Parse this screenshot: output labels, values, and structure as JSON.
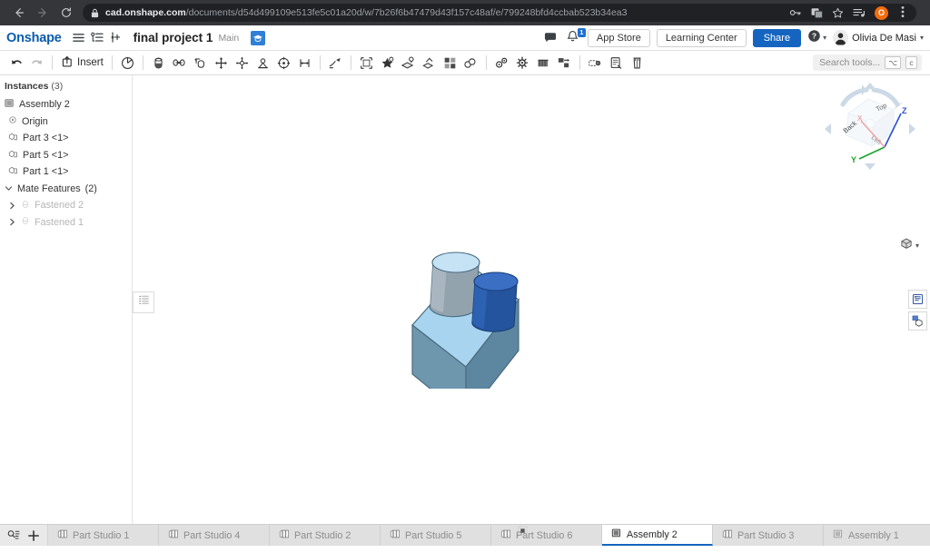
{
  "browser": {
    "back_icon": "back-arrow-icon",
    "forward_icon": "forward-arrow-icon",
    "reload_icon": "reload-icon",
    "url_domain": "cad.onshape.com",
    "url_path": "/documents/d54d499109e513fe5c01a20d/w/7b26f6b47479d43f157c48af/e/799248bfd4ccbab523b34ea3",
    "lock_icon": "lock-icon",
    "key_icon": "key-icon",
    "translate_icon": "translate-icon",
    "bookmark_icon": "star-icon",
    "media_icon": "media-list-icon",
    "profile_initial": "O",
    "menu_icon": "kebab-menu-icon"
  },
  "header": {
    "logo": "Onshape",
    "menu_icon": "hamburger-menu-icon",
    "tree_icon": "document-tree-icon",
    "versions_icon": "version-branch-icon",
    "doc_title": "final project 1",
    "branch": "Main",
    "learning_icon": "graduation-cap-icon",
    "comment_icon": "comment-icon",
    "bell_icon": "notification-bell-icon",
    "notification_count": "1",
    "app_store": "App Store",
    "learning_center": "Learning Center",
    "share": "Share",
    "help_icon": "help-circle-icon",
    "user_name": "Olivia De Masi",
    "avatar_icon": "user-avatar-icon"
  },
  "toolbar": {
    "undo_icon": "undo-arrow-icon",
    "redo_icon": "redo-arrow-icon",
    "insert_label": "Insert",
    "insert_icon": "insert-part-icon",
    "search_placeholder": "Search tools...",
    "search_key_1": "⌥",
    "search_key_2": "c",
    "tools": [
      {
        "name": "fix-tool",
        "icon": "fix-circle-icon"
      },
      {
        "name": "group-tool",
        "icon": "group-cylinder-icon"
      },
      {
        "name": "revolute-mate",
        "icon": "revolute-mate-icon"
      },
      {
        "name": "cylindrical-mate",
        "icon": "cylindrical-mate-icon"
      },
      {
        "name": "slider-mate",
        "icon": "slider-mate-icon"
      },
      {
        "name": "planar-mate",
        "icon": "planar-mate-icon"
      },
      {
        "name": "ball-mate",
        "icon": "ball-mate-icon"
      },
      {
        "name": "pin-slot-mate",
        "icon": "pin-slot-mate-icon"
      },
      {
        "name": "parallel-mate",
        "icon": "parallel-mate-icon"
      },
      {
        "name": "tangent-mate",
        "icon": "tangent-mate-icon"
      },
      {
        "name": "fastened-mate",
        "icon": "fastened-mate-icon"
      },
      {
        "name": "mate-connector",
        "icon": "mate-connector-icon"
      },
      {
        "name": "group-instances",
        "icon": "group-instances-icon"
      },
      {
        "name": "replicate-tool",
        "icon": "replicate-icon"
      },
      {
        "name": "pattern-tool",
        "icon": "pattern-icon"
      },
      {
        "name": "gear-relation",
        "icon": "gear-relation-icon"
      },
      {
        "name": "screw-relation",
        "icon": "screw-relation-icon"
      },
      {
        "name": "rack-pinion",
        "icon": "rack-pinion-icon"
      },
      {
        "name": "linear-relation",
        "icon": "linear-relation-icon"
      },
      {
        "name": "exploded-view",
        "icon": "exploded-view-icon"
      },
      {
        "name": "bill-of-materials",
        "icon": "bom-icon"
      },
      {
        "name": "measure-tool",
        "icon": "measure-icon"
      }
    ]
  },
  "tree": {
    "header_label": "Instances",
    "header_count": "(3)",
    "root": {
      "label": "Assembly 2",
      "icon": "assembly-icon"
    },
    "origin": {
      "label": "Origin",
      "icon": "origin-icon"
    },
    "instances": [
      {
        "label": "Part 3 <1>",
        "icon": "part-icon"
      },
      {
        "label": "Part 5 <1>",
        "icon": "part-icon"
      },
      {
        "label": "Part 1 <1>",
        "icon": "part-icon"
      }
    ],
    "mate_features": {
      "label": "Mate Features",
      "count": "(2)"
    },
    "mates": [
      {
        "label": "Fastened 2",
        "icon": "fastened-feature-icon"
      },
      {
        "label": "Fastened 1",
        "icon": "fastened-feature-icon"
      }
    ]
  },
  "viewport": {
    "panel_toggle_icon": "list-panel-icon",
    "display_list_icon": "display-list-icon",
    "appearance_icon": "appearance-cube-icon",
    "origin_marker_icon": "origin-marker-icon",
    "view_mode_icon": "shaded-cube-icon",
    "viewcube": {
      "axis_x_label": "X",
      "axis_y_label": "Y",
      "axis_z_label": "Z",
      "face_top": "Top",
      "face_back": "Back",
      "face_left": "Left"
    },
    "model": {
      "box_color": "#5d86a0",
      "box_top_color": "#a8d4ef",
      "box_front_color": "#7aa6bd",
      "cylinder_grey": "#9aa7b0",
      "cylinder_blue": "#24549e",
      "cylinder_blue_top": "#3a6fc4",
      "cylinder_grey_top": "#c6e3f6"
    }
  },
  "tabbar": {
    "search_tabs_icon": "search-tabs-icon",
    "add_tab_icon": "add-tab-icon",
    "tabs": [
      {
        "label": "Part Studio 1",
        "icon": "part-studio-icon",
        "active": false
      },
      {
        "label": "Part Studio 4",
        "icon": "part-studio-icon",
        "active": false
      },
      {
        "label": "Part Studio 2",
        "icon": "part-studio-icon",
        "active": false
      },
      {
        "label": "Part Studio 5",
        "icon": "part-studio-icon",
        "active": false
      },
      {
        "label": "Part Studio 6",
        "icon": "part-studio-icon",
        "active": false
      },
      {
        "label": "Assembly 2",
        "icon": "assembly-tab-icon",
        "active": true
      },
      {
        "label": "Part Studio 3",
        "icon": "part-studio-icon",
        "active": false
      },
      {
        "label": "Assembly 1",
        "icon": "assembly-tab-icon",
        "active": false
      }
    ]
  },
  "colors": {
    "brand_blue": "#0b5cad",
    "share_blue": "#1565c0",
    "chrome_dark": "#35363a",
    "omnibox_dark": "#202124"
  }
}
